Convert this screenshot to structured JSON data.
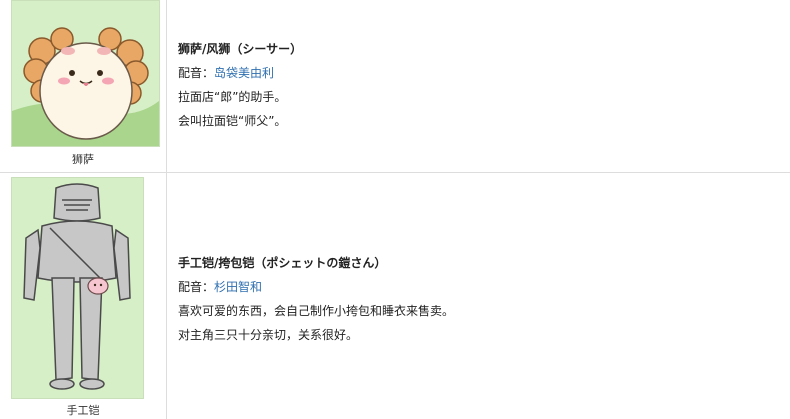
{
  "characters": [
    {
      "caption": "狮萨",
      "name": "狮萨/风狮（シーサー）",
      "cv_label": "配音：",
      "cv_name": "岛袋美由利",
      "desc": [
        "拉面店“郎”的助手。",
        "会叫拉面铠“师父”。"
      ]
    },
    {
      "caption": "手工铠",
      "name": "手工铠/挎包铠（ポシェットの鎧さん）",
      "cv_label": "配音：",
      "cv_name": "杉田智和",
      "desc": [
        "喜欢可爱的东西，会自己制作小挎包和睡衣来售卖。",
        "对主角三只十分亲切，关系很好。"
      ]
    }
  ],
  "colors": {
    "link": "#2f6fb0",
    "portrait_bg": "#d4edc0",
    "border": "#dddddd"
  }
}
